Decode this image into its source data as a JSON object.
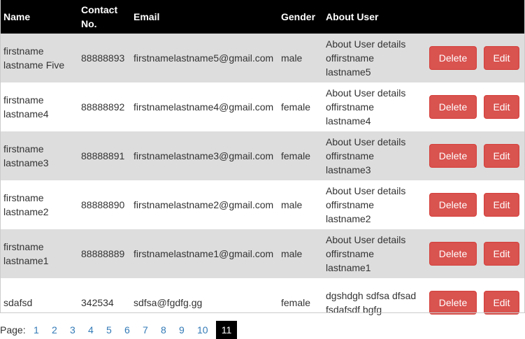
{
  "table": {
    "headers": {
      "name": "Name",
      "contact": "Contact\nNo.",
      "email": "Email",
      "gender": "Gender",
      "about": "About User"
    },
    "delete_label": "Delete",
    "edit_label": "Edit",
    "rows": [
      {
        "name": "firstname\nlastname Five",
        "contact": "88888893",
        "email": "firstnamelastname5@gmail.com",
        "gender": "male",
        "about": "About User details\noffirstname\nlastname5"
      },
      {
        "name": "firstname\nlastname4",
        "contact": "88888892",
        "email": "firstnamelastname4@gmail.com",
        "gender": "female",
        "about": "About User details\noffirstname\nlastname4"
      },
      {
        "name": "firstname\nlastname3",
        "contact": "88888891",
        "email": "firstnamelastname3@gmail.com",
        "gender": "female",
        "about": "About User details\noffirstname\nlastname3"
      },
      {
        "name": "firstname\nlastname2",
        "contact": "88888890",
        "email": "firstnamelastname2@gmail.com",
        "gender": "male",
        "about": "About User details\noffirstname\nlastname2"
      },
      {
        "name": "firstname\nlastname1",
        "contact": "88888889",
        "email": "firstnamelastname1@gmail.com",
        "gender": "male",
        "about": "About User details\noffirstname\nlastname1"
      },
      {
        "name": "sdafsd",
        "contact": "342534",
        "email": "sdfsa@fgdfg.gg",
        "gender": "female",
        "about": "dgshdgh sdfsa dfsad\nfsdafsdf bgfg"
      }
    ]
  },
  "pagination": {
    "label": "Page:",
    "pages": [
      "1",
      "2",
      "3",
      "4",
      "5",
      "6",
      "7",
      "8",
      "9",
      "10"
    ],
    "current": "11"
  },
  "colors": {
    "header_bg": "#000000",
    "row_alt_bg": "#dddddd",
    "button_bg": "#d9534f",
    "link": "#337ab7"
  }
}
